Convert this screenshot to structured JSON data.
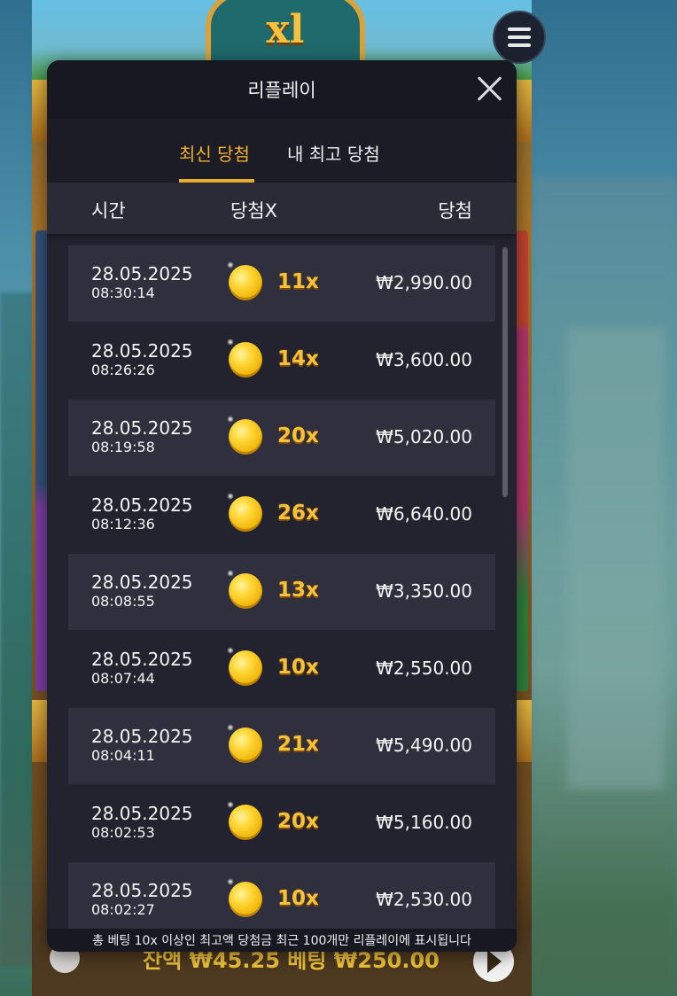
{
  "background": {
    "game_multiplier": "xl",
    "bottom_bar_text": "잔액 ₩45.25 베팅 ₩250.00"
  },
  "modal": {
    "title": "리플레이",
    "tabs": [
      {
        "label": "최신 당첨",
        "active": true
      },
      {
        "label": "내 최고 당첨",
        "active": false
      }
    ],
    "columns": {
      "time": "시간",
      "multiplier": "당첨X",
      "win": "당첨"
    },
    "rows": [
      {
        "date": "28.05.2025",
        "time": "08:30:14",
        "multiplier": "11x",
        "win": "₩2,990.00"
      },
      {
        "date": "28.05.2025",
        "time": "08:26:26",
        "multiplier": "14x",
        "win": "₩3,600.00"
      },
      {
        "date": "28.05.2025",
        "time": "08:19:58",
        "multiplier": "20x",
        "win": "₩5,020.00"
      },
      {
        "date": "28.05.2025",
        "time": "08:12:36",
        "multiplier": "26x",
        "win": "₩6,640.00"
      },
      {
        "date": "28.05.2025",
        "time": "08:08:55",
        "multiplier": "13x",
        "win": "₩3,350.00"
      },
      {
        "date": "28.05.2025",
        "time": "08:07:44",
        "multiplier": "10x",
        "win": "₩2,550.00"
      },
      {
        "date": "28.05.2025",
        "time": "08:04:11",
        "multiplier": "21x",
        "win": "₩5,490.00"
      },
      {
        "date": "28.05.2025",
        "time": "08:02:53",
        "multiplier": "20x",
        "win": "₩5,160.00"
      },
      {
        "date": "28.05.2025",
        "time": "08:02:27",
        "multiplier": "10x",
        "win": "₩2,530.00"
      }
    ],
    "footer": "총 베팅 10x 이상인 최고액 당첨금 최근 100개만 리플레이에 표시됩니다"
  },
  "colors": {
    "accent": "#f0b02d",
    "modal_bg": "#23232f",
    "header_bg": "#171822"
  }
}
